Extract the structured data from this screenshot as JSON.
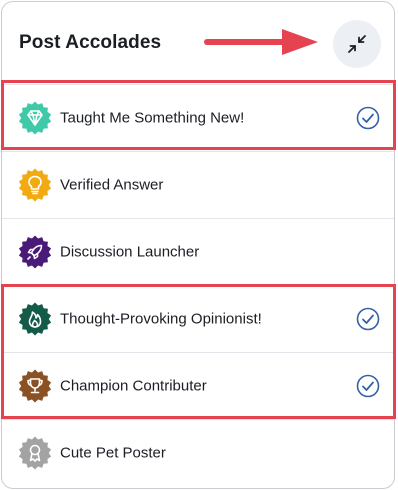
{
  "panel": {
    "title": "Post Accolades",
    "collapse_button_icon": "collapse-arrows-icon"
  },
  "accolades": [
    {
      "label": "Taught Me Something New!",
      "icon": "diamond-badge-icon",
      "badge_color": "#3fc9a8",
      "selected": true
    },
    {
      "label": "Verified Answer",
      "icon": "lightbulb-badge-icon",
      "badge_color": "#f2aa12",
      "selected": false
    },
    {
      "label": "Discussion Launcher",
      "icon": "rocket-badge-icon",
      "badge_color": "#4a1a79",
      "selected": false
    },
    {
      "label": "Thought-Provoking Opinionist!",
      "icon": "flame-badge-icon",
      "badge_color": "#145a48",
      "selected": true
    },
    {
      "label": "Champion Contributer",
      "icon": "trophy-badge-icon",
      "badge_color": "#8a5124",
      "selected": true
    },
    {
      "label": "Cute Pet Poster",
      "icon": "ribbon-badge-icon",
      "badge_color": "#a3a3a3",
      "selected": false
    }
  ],
  "colors": {
    "annotation_red": "#e5434f",
    "check_blue": "#3560a8"
  }
}
